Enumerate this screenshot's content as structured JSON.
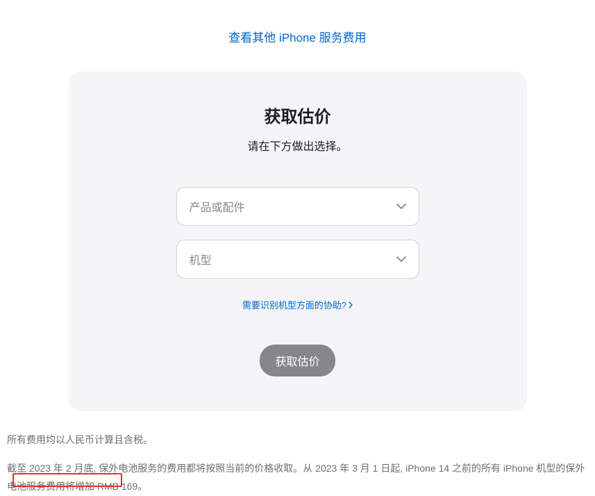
{
  "top_link": "查看其他 iPhone 服务费用",
  "card": {
    "title": "获取估价",
    "subtitle": "请在下方做出选择。",
    "select_product_placeholder": "产品或配件",
    "select_model_placeholder": "机型",
    "help_link": "需要识别机型方面的协助?",
    "submit_label": "获取估价"
  },
  "footer": {
    "tax_note": "所有费用均以人民币计算且含税。",
    "notice_full": "截至 2023 年 2 月底, 保外电池服务的费用都将按照当前的价格收取。从 2023 年 3 月 1 日起, iPhone 14 之前的所有 iPhone 机型的保外电池服务费用将增加 RMB 169。"
  }
}
